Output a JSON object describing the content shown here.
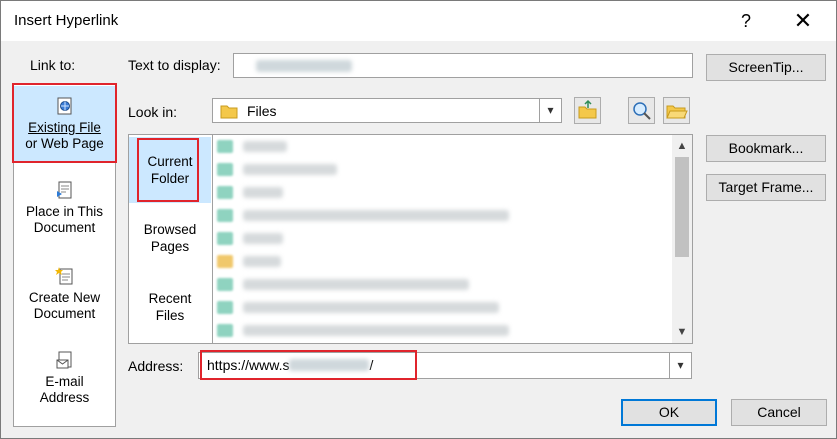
{
  "window": {
    "title": "Insert Hyperlink",
    "help": "?",
    "close": "✕"
  },
  "link_to": {
    "label": "Link to:",
    "items": [
      {
        "line1": "Existing File",
        "line2": "or Web Page",
        "icon": "globe-document-icon",
        "selected": true
      },
      {
        "line1": "Place in This",
        "line2": "Document",
        "icon": "document-place-icon",
        "selected": false
      },
      {
        "line1": "Create New",
        "line2": "Document",
        "icon": "new-document-icon",
        "selected": false
      },
      {
        "line1": "E-mail",
        "line2": "Address",
        "icon": "email-icon",
        "selected": false
      }
    ]
  },
  "text_to_display": {
    "label": "Text to display:",
    "value": ""
  },
  "screentip_button": "ScreenTip...",
  "look_in": {
    "label": "Look in:",
    "value": "Files",
    "icon": "folder-icon"
  },
  "nav": [
    {
      "line1": "Current",
      "line2": "Folder",
      "selected": true
    },
    {
      "line1": "Browsed",
      "line2": "Pages",
      "selected": false
    },
    {
      "line1": "Recent",
      "line2": "Files",
      "selected": false
    }
  ],
  "files": [
    {
      "name": "",
      "icon": "file-icon"
    },
    {
      "name": "",
      "icon": "file-icon"
    },
    {
      "name": "",
      "icon": "file-icon"
    },
    {
      "name": "",
      "icon": "file-icon"
    },
    {
      "name": "",
      "icon": "file-icon"
    },
    {
      "name": "",
      "icon": "folder-icon"
    },
    {
      "name": "",
      "icon": "file-icon"
    },
    {
      "name": "",
      "icon": "file-icon"
    },
    {
      "name": "",
      "icon": "file-icon"
    }
  ],
  "bookmark_button": "Bookmark...",
  "target_frame_button": "Target Frame...",
  "address": {
    "label": "Address:",
    "value": "https://www.s",
    "value_end": "/"
  },
  "ok_button": "OK",
  "cancel_button": "Cancel",
  "colors": {
    "highlight": "#e0242c",
    "selection": "#cce8ff",
    "accent": "#0078d7"
  }
}
